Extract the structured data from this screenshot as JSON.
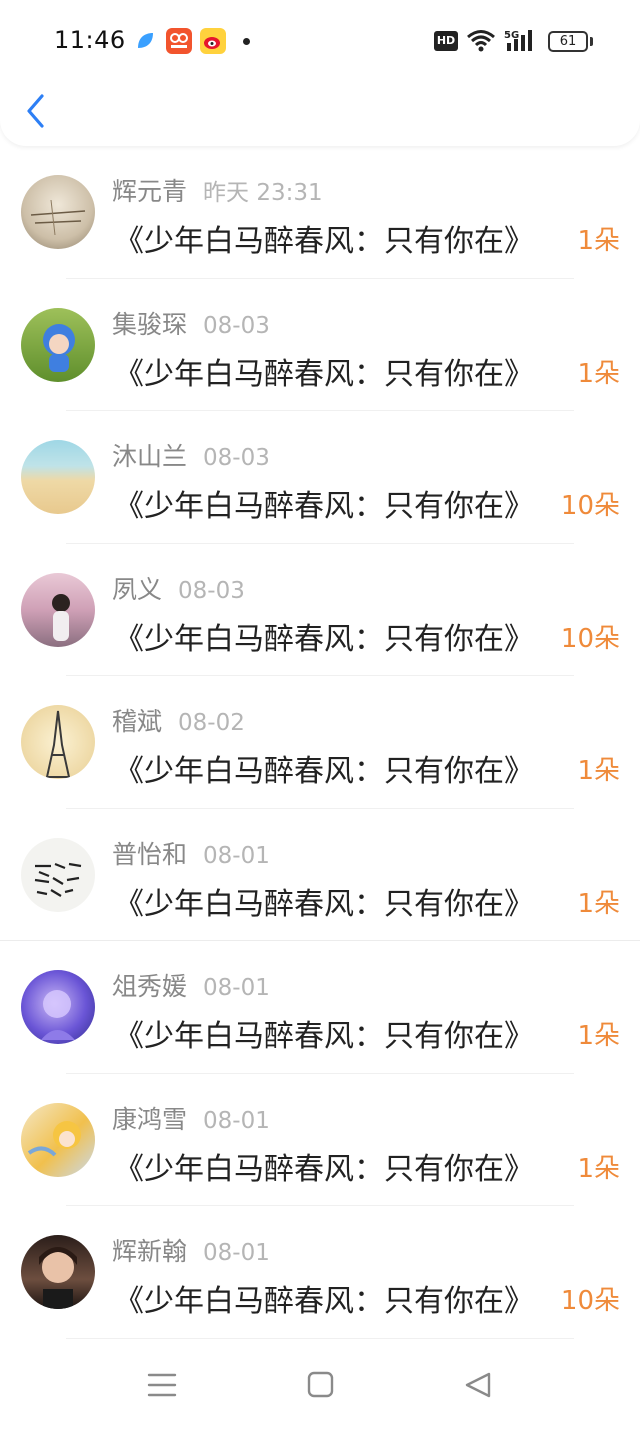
{
  "status_bar": {
    "time": "11:46",
    "network": "5G",
    "battery": "61"
  },
  "header": {
    "back_icon": "chevron-left-icon",
    "accent": "#2d7ff5"
  },
  "list": {
    "items": [
      {
        "name": "辉元青",
        "date": "昨天 23:31",
        "title": "《少年白马醉春风：只有你在》",
        "count": "1朵"
      },
      {
        "name": "集骏琛",
        "date": "08-03",
        "title": "《少年白马醉春风：只有你在》",
        "count": "1朵"
      },
      {
        "name": "沐山兰",
        "date": "08-03",
        "title": "《少年白马醉春风：只有你在》",
        "count": "10朵"
      },
      {
        "name": "夙义",
        "date": "08-03",
        "title": "《少年白马醉春风：只有你在》",
        "count": "10朵"
      },
      {
        "name": "稽斌",
        "date": "08-02",
        "title": "《少年白马醉春风：只有你在》",
        "count": "1朵"
      },
      {
        "name": "普怡和",
        "date": "08-01",
        "title": "《少年白马醉春风：只有你在》",
        "count": "1朵"
      },
      {
        "name": "俎秀媛",
        "date": "08-01",
        "title": "《少年白马醉春风：只有你在》",
        "count": "1朵"
      },
      {
        "name": "康鸿雪",
        "date": "08-01",
        "title": "《少年白马醉春风：只有你在》",
        "count": "1朵"
      },
      {
        "name": "辉新翰",
        "date": "08-01",
        "title": "《少年白马醉春风：只有你在》",
        "count": "10朵"
      }
    ],
    "count_color": "#ef8a3a",
    "avatar_art_text": "浅律清风 治有归宿 却所说"
  },
  "navbar": {
    "menu_icon": "menu-icon",
    "home_icon": "home-icon",
    "back_icon": "back-triangle-icon"
  }
}
